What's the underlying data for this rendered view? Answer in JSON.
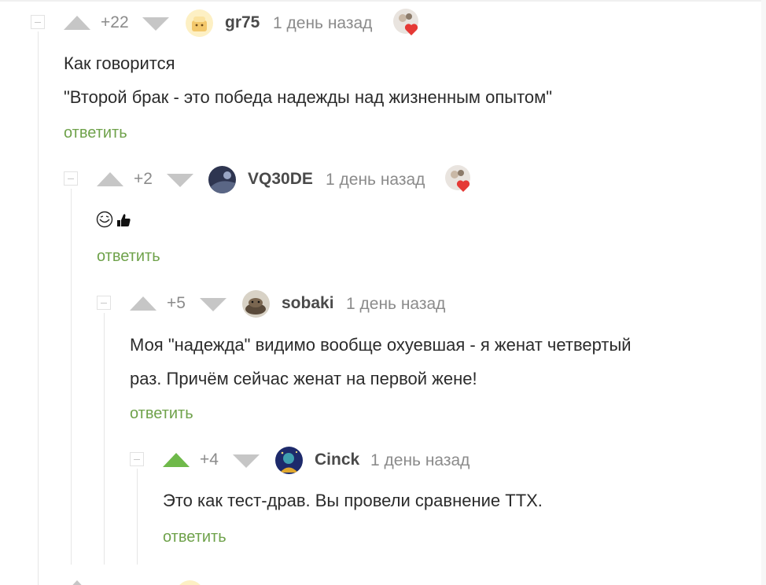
{
  "comments": [
    {
      "rating": "+22",
      "username": "gr75",
      "time": "1 день назад",
      "lines": [
        "Как говорится",
        "\"Второй брак - это победа надежды над жизненным опытом\""
      ],
      "reply_label": "ответить",
      "upvoted": false
    },
    {
      "rating": "+2",
      "username": "VQ30DE",
      "time": "1 день назад",
      "lines": [],
      "reply_label": "ответить",
      "upvoted": false
    },
    {
      "rating": "+5",
      "username": "sobaki",
      "time": "1 день назад",
      "lines": [
        "Моя \"надежда\" видимо вообще охуевшая - я женат четвертый",
        "раз. Причём сейчас женат на первой жене!"
      ],
      "reply_label": "ответить",
      "upvoted": false
    },
    {
      "rating": "+4",
      "username": "Cinck",
      "time": "1 день назад",
      "lines": [
        "Это как тест-драв. Вы провели сравнение ТТХ."
      ],
      "reply_label": "ответить",
      "upvoted": true
    }
  ],
  "colors": {
    "accent_green": "#6fb94a",
    "reply_green": "#6fa24b",
    "muted": "#8b8b8b",
    "heart_red": "#e53935"
  }
}
